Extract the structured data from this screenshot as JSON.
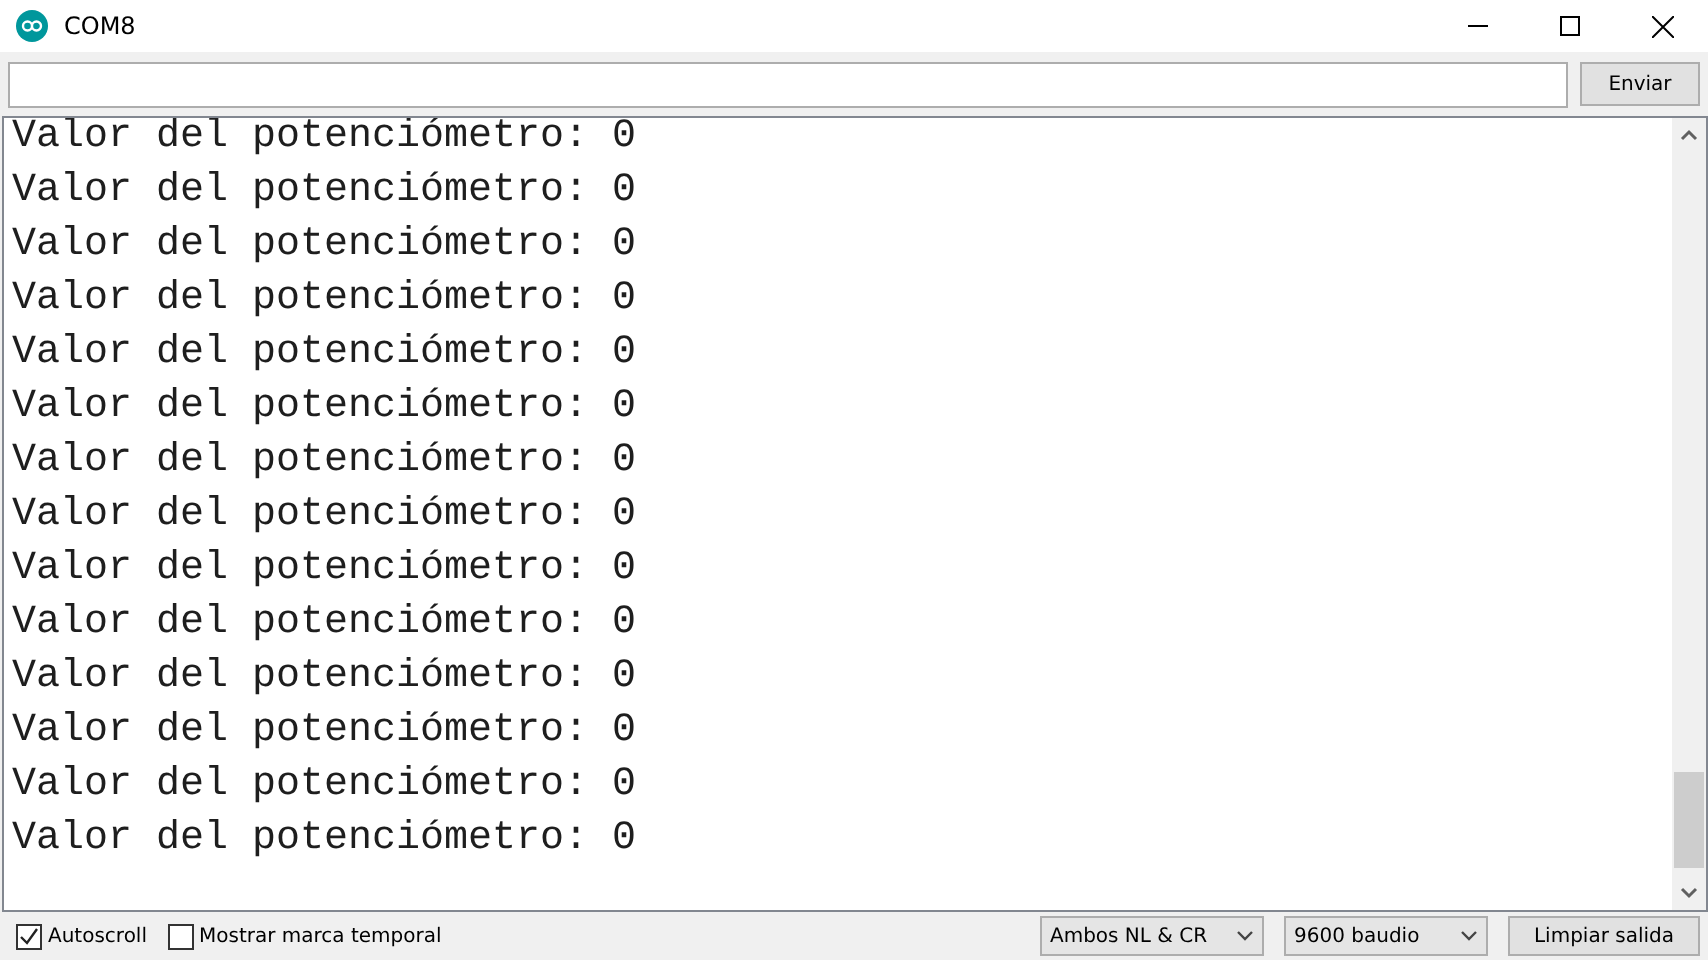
{
  "window": {
    "title": "COM8"
  },
  "send_bar": {
    "button": "Enviar"
  },
  "output": {
    "lines": [
      "Valor del potenciómetro: 0",
      "Valor del potenciómetro: 0",
      "Valor del potenciómetro: 0",
      "Valor del potenciómetro: 0",
      "Valor del potenciómetro: 0",
      "Valor del potenciómetro: 0",
      "Valor del potenciómetro: 0",
      "Valor del potenciómetro: 0",
      "Valor del potenciómetro: 0",
      "Valor del potenciómetro: 0",
      "Valor del potenciómetro: 0",
      "Valor del potenciómetro: 0",
      "Valor del potenciómetro: 0",
      "Valor del potenciómetro: 0"
    ]
  },
  "status_bar": {
    "checkboxes": [
      {
        "label": "Autoscroll",
        "checked": true
      },
      {
        "label": "Mostrar marca temporal",
        "checked": false
      }
    ],
    "selects": [
      {
        "value": "Ambos NL & CR"
      },
      {
        "value": "9600 baudio"
      }
    ],
    "button": "Limpiar salida"
  }
}
